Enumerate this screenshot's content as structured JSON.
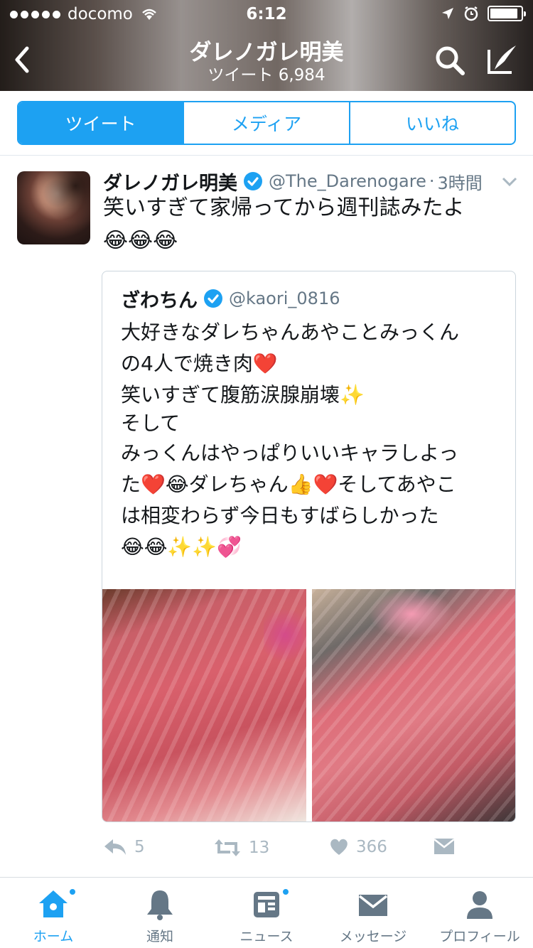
{
  "status_bar": {
    "carrier": "docomo",
    "time": "6:12",
    "battery_percent": 90
  },
  "nav": {
    "title": "ダレノガレ明美",
    "subtitle": "ツイート 6,984"
  },
  "tabs": [
    {
      "label": "ツイート",
      "active": true
    },
    {
      "label": "メディア",
      "active": false
    },
    {
      "label": "いいね",
      "active": false
    }
  ],
  "tweet": {
    "name": "ダレノガレ明美",
    "handle": "@The_Darenogare",
    "separator": "·",
    "time": "3時間",
    "text": "笑いすぎて家帰ってから週刊誌みたよ",
    "emoji": "😂😂😂",
    "quote": {
      "name": "ざわちん",
      "handle": "@kaori_0816",
      "lines": [
        "大好きなダレちゃんあやことみっくん",
        "の4人で焼き肉❤️",
        "笑いすぎて腹筋涙腺崩壊✨",
        "そして",
        "みっくんはやっぱりいいキャラしよっ",
        "た❤️😂ダレちゃん👍❤️そしてあやこ",
        "は相変わらず今日もすばらしかった",
        "😂😂✨✨💞"
      ]
    },
    "actions": {
      "reply_count": "5",
      "retweet_count": "13",
      "like_count": "366"
    }
  },
  "tabbar": [
    {
      "label": "ホーム",
      "icon": "home-icon",
      "active": true,
      "badge": true
    },
    {
      "label": "通知",
      "icon": "bell-icon",
      "active": false,
      "badge": false
    },
    {
      "label": "ニュース",
      "icon": "news-icon",
      "active": false,
      "badge": true
    },
    {
      "label": "メッセージ",
      "icon": "envelope-icon",
      "active": false,
      "badge": false
    },
    {
      "label": "プロフィール",
      "icon": "person-icon",
      "active": false,
      "badge": false
    }
  ],
  "colors": {
    "accent": "#1da1f2",
    "muted": "#657786",
    "icon_muted": "#aab8c2"
  }
}
